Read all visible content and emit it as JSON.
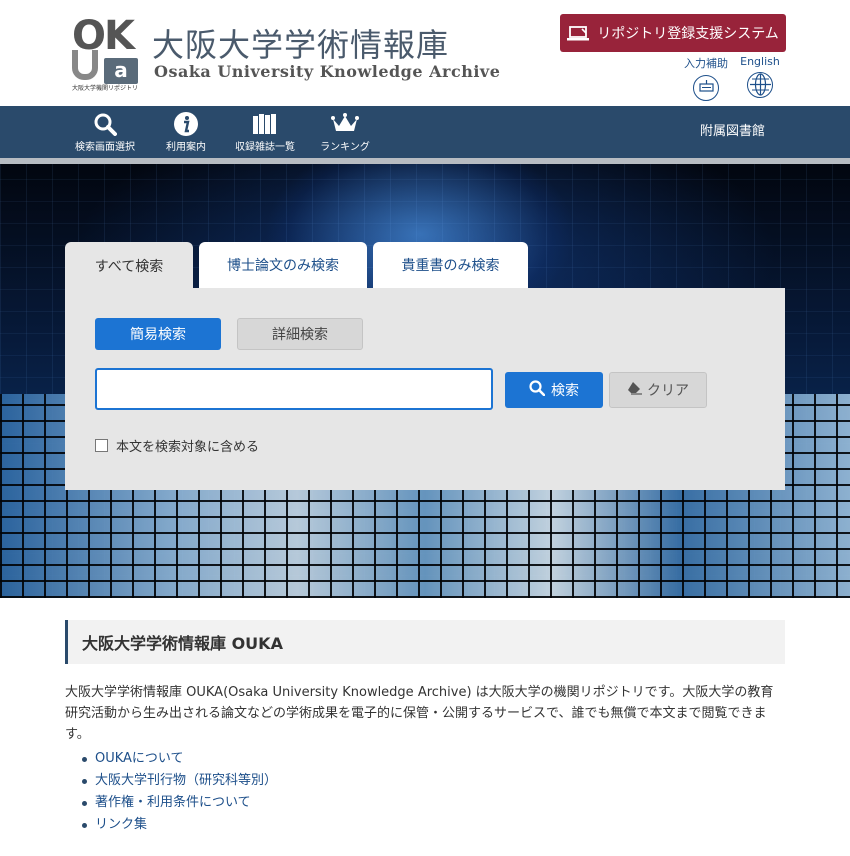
{
  "header": {
    "logo_letters": "OKUa",
    "logo_caption": "大阪大学機関リポジトリ",
    "logo_small": "Osaka University Knowledge Archive",
    "title_ja": "大阪大学学術情報庫",
    "title_en": "Osaka University Knowledge Archive",
    "repo_button_label": "リポジトリ登録支援システム",
    "accessibility_label": "入力補助",
    "english_label": "English"
  },
  "nav": {
    "items": [
      {
        "label": "検索画面選択",
        "icon": "search-icon"
      },
      {
        "label": "利用案内",
        "icon": "info-icon"
      },
      {
        "label": "収録雑誌一覧",
        "icon": "books-icon"
      },
      {
        "label": "ランキング",
        "icon": "crown-icon"
      }
    ],
    "library_label": "附属図書館"
  },
  "search": {
    "tabs": [
      "すべて検索",
      "博士論文のみ検索",
      "貴重書のみ検索"
    ],
    "active_tab": "すべて検索",
    "mode_simple": "簡易検索",
    "mode_detail": "詳細検索",
    "input_value": "",
    "search_button": "検索",
    "clear_button": "クリア",
    "fulltext_label": "本文を検索対象に含める"
  },
  "content": {
    "heading": "大阪大学学術情報庫 OUKA",
    "description": "大阪大学学術情報庫 OUKA(Osaka University Knowledge Archive) は大阪大学の機関リポジトリです。大阪大学の教育研究活動から生み出される論文などの学術成果を電子的に保管・公開するサービスで、誰でも無償で本文まで閲覧できます。",
    "links": [
      "OUKAについて",
      "大阪大学刊行物（研究科等別）",
      "著作権・利用条件について",
      "リンク集"
    ]
  },
  "colors": {
    "nav_bg": "#2a4a6b",
    "accent_blue": "#1c74d3",
    "repo_button": "#98233a",
    "link": "#1d4f8a"
  }
}
